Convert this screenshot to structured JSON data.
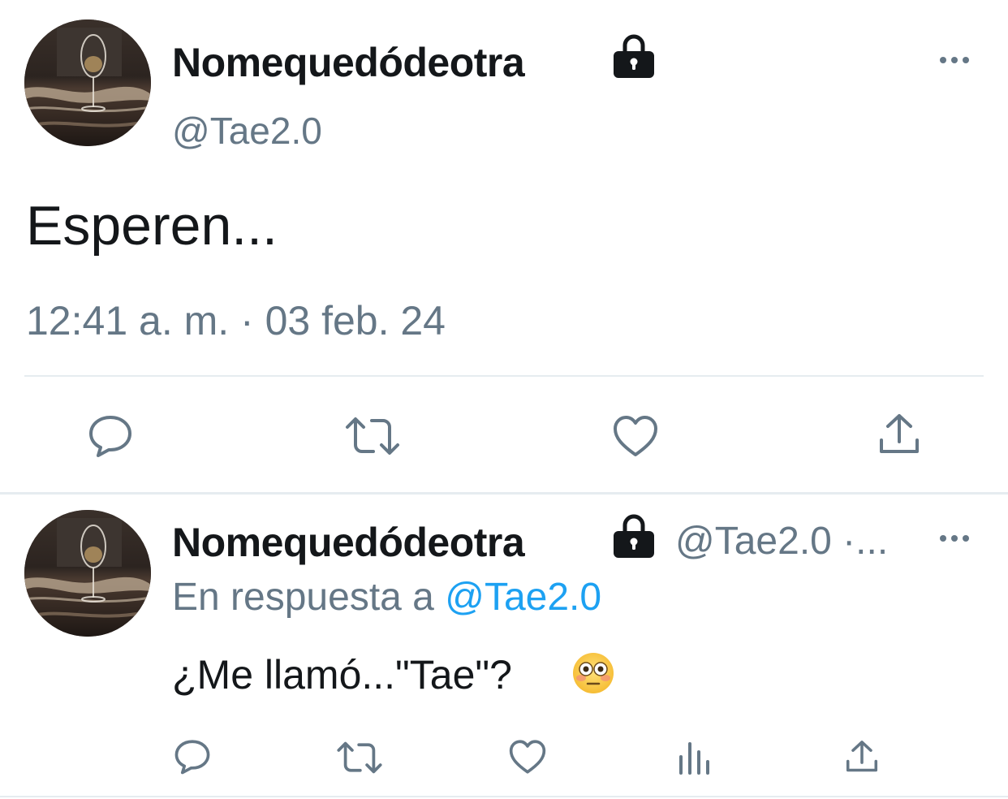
{
  "tweet": {
    "display_name": "Nomequedódeotra",
    "handle": "@Tae2.0",
    "text": "Esperen...",
    "timestamp": "12:41 a. m. · 03 feb. 24",
    "actions": [
      "reply-icon",
      "retweet-icon",
      "like-icon",
      "share-icon"
    ]
  },
  "reply": {
    "display_name": "Nomequedódeotra",
    "handle_time": "@Tae2.0 ·...",
    "reply_prefix": "En respuesta a ",
    "reply_to": "@Tae2.0",
    "text": "¿Me llamó...\"Tae\"?",
    "emoji": "flushed-face",
    "actions": [
      "reply-icon",
      "retweet-icon",
      "like-icon",
      "analytics-icon",
      "share-icon"
    ]
  },
  "colors": {
    "text": "#14171a",
    "secondary": "#657786",
    "link": "#1da1f2",
    "divider": "#e6ecf0"
  }
}
